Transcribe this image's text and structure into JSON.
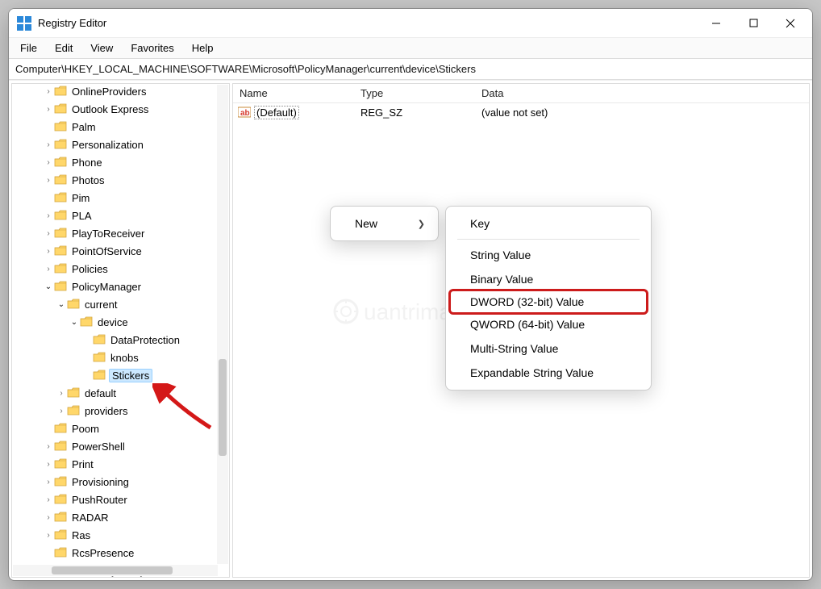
{
  "window": {
    "title": "Registry Editor"
  },
  "menu": {
    "file": "File",
    "edit": "Edit",
    "view": "View",
    "favorites": "Favorites",
    "help": "Help"
  },
  "address": "Computer\\HKEY_LOCAL_MACHINE\\SOFTWARE\\Microsoft\\PolicyManager\\current\\device\\Stickers",
  "columns": {
    "name": "Name",
    "type": "Type",
    "data": "Data"
  },
  "value_row": {
    "name": "(Default)",
    "type": "REG_SZ",
    "data": "(value not set)"
  },
  "tree": [
    {
      "label": "OnlineProviders",
      "indent": 2,
      "exp": ">"
    },
    {
      "label": "Outlook Express",
      "indent": 2,
      "exp": ">"
    },
    {
      "label": "Palm",
      "indent": 2,
      "exp": ""
    },
    {
      "label": "Personalization",
      "indent": 2,
      "exp": ">"
    },
    {
      "label": "Phone",
      "indent": 2,
      "exp": ">"
    },
    {
      "label": "Photos",
      "indent": 2,
      "exp": ">"
    },
    {
      "label": "Pim",
      "indent": 2,
      "exp": ""
    },
    {
      "label": "PLA",
      "indent": 2,
      "exp": ">"
    },
    {
      "label": "PlayToReceiver",
      "indent": 2,
      "exp": ">"
    },
    {
      "label": "PointOfService",
      "indent": 2,
      "exp": ">"
    },
    {
      "label": "Policies",
      "indent": 2,
      "exp": ">"
    },
    {
      "label": "PolicyManager",
      "indent": 2,
      "exp": "v"
    },
    {
      "label": "current",
      "indent": 3,
      "exp": "v"
    },
    {
      "label": "device",
      "indent": 4,
      "exp": "v"
    },
    {
      "label": "DataProtection",
      "indent": 5,
      "exp": ""
    },
    {
      "label": "knobs",
      "indent": 5,
      "exp": ""
    },
    {
      "label": "Stickers",
      "indent": 5,
      "exp": "",
      "selected": true
    },
    {
      "label": "default",
      "indent": 3,
      "exp": ">"
    },
    {
      "label": "providers",
      "indent": 3,
      "exp": ">"
    },
    {
      "label": "Poom",
      "indent": 2,
      "exp": ""
    },
    {
      "label": "PowerShell",
      "indent": 2,
      "exp": ">"
    },
    {
      "label": "Print",
      "indent": 2,
      "exp": ">"
    },
    {
      "label": "Provisioning",
      "indent": 2,
      "exp": ">"
    },
    {
      "label": "PushRouter",
      "indent": 2,
      "exp": ">"
    },
    {
      "label": "RADAR",
      "indent": 2,
      "exp": ">"
    },
    {
      "label": "Ras",
      "indent": 2,
      "exp": ">"
    },
    {
      "label": "RcsPresence",
      "indent": 2,
      "exp": ""
    },
    {
      "label": "Reliability Analysis",
      "indent": 2,
      "exp": ">"
    }
  ],
  "ctx1": {
    "new": "New"
  },
  "ctx2": {
    "key": "Key",
    "string": "String Value",
    "binary": "Binary Value",
    "dword": "DWORD (32-bit) Value",
    "qword": "QWORD (64-bit) Value",
    "multi": "Multi-String Value",
    "expand": "Expandable String Value"
  },
  "watermark": "uantrimar"
}
